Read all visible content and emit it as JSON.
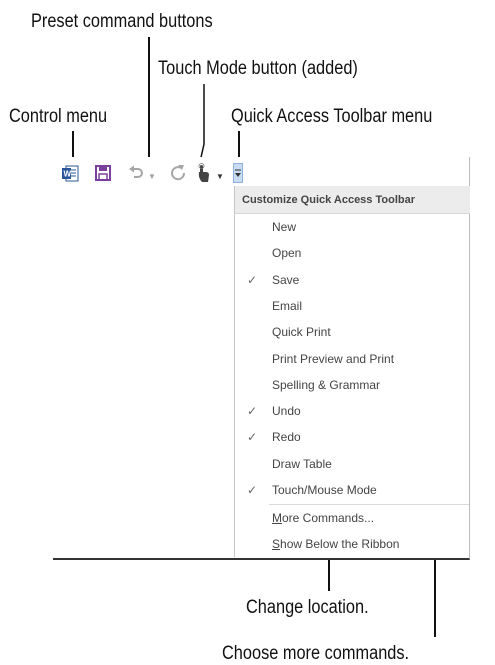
{
  "callouts": {
    "preset_buttons": "Preset command buttons",
    "touch_mode": "Touch Mode button (added)",
    "control_menu": "Control menu",
    "qat_menu": "Quick Access Toolbar menu",
    "change_location": "Change location.",
    "choose_more": "Choose more commands."
  },
  "toolbar": {
    "icons": [
      "word-app-icon",
      "save-icon",
      "undo-icon",
      "redo-icon",
      "touch-mode-icon",
      "qat-dropdown-icon"
    ]
  },
  "menu": {
    "title": "Customize Quick Access Toolbar",
    "items": [
      {
        "label": "New",
        "checked": false
      },
      {
        "label": "Open",
        "checked": false
      },
      {
        "label": "Save",
        "checked": true
      },
      {
        "label": "Email",
        "checked": false
      },
      {
        "label": "Quick Print",
        "checked": false
      },
      {
        "label": "Print Preview and Print",
        "checked": false
      },
      {
        "label": "Spelling & Grammar",
        "checked": false
      },
      {
        "label": "Undo",
        "checked": true
      },
      {
        "label": "Redo",
        "checked": true
      },
      {
        "label": "Draw Table",
        "checked": false
      },
      {
        "label": "Touch/Mouse Mode",
        "checked": true
      }
    ],
    "more_commands": {
      "accel": "M",
      "rest": "ore Commands..."
    },
    "show_below": {
      "accel": "S",
      "rest": "how Below the Ribbon"
    },
    "check_glyph": "✓"
  },
  "colors": {
    "word_blue": "#2b579a",
    "save_purple": "#7b3fa0",
    "qat_blue": "#c7dcf2"
  }
}
